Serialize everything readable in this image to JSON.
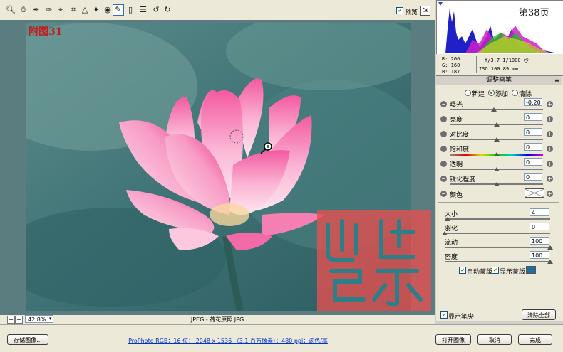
{
  "toolbar": {
    "tools": [
      "zoom-icon",
      "hand-icon",
      "white-balance-icon",
      "color-sampler-icon",
      "target-adjustment-icon",
      "crop-icon",
      "straighten-icon",
      "spot-removal-icon",
      "red-eye-icon",
      "adjustment-brush-icon",
      "graduated-filter-icon",
      "preferences-icon",
      "rotate-left-icon",
      "rotate-right-icon"
    ],
    "preview_label": "预览"
  },
  "image": {
    "caption": "附图31",
    "page_tag": "第38页"
  },
  "status": {
    "zoom": "42.8%",
    "filename": "JPEG - 荷花原照.JPG"
  },
  "info": {
    "r": "R:  206",
    "g": "G:  160",
    "b": "B:  187",
    "exposure": "f/3.7   1/1000 秒",
    "iso": "ISO 100   89 mm"
  },
  "panel": {
    "title": "调整画笔",
    "modes": [
      "新建",
      "添加",
      "清除"
    ],
    "active_mode": 1,
    "sliders": [
      {
        "label": "曝光",
        "value": "-0.20",
        "pos": 0.47
      },
      {
        "label": "亮度",
        "value": "0",
        "pos": 0.5
      },
      {
        "label": "对比度",
        "value": "0",
        "pos": 0.5
      },
      {
        "label": "饱和度",
        "value": "0",
        "pos": 0.5
      },
      {
        "label": "透明",
        "value": "0",
        "pos": 0.5
      },
      {
        "label": "锐化程度",
        "value": "0",
        "pos": 0.5
      }
    ],
    "color_label": "颜色",
    "brush": [
      {
        "label": "大小",
        "value": "4",
        "pos": 0.03
      },
      {
        "label": "羽化",
        "value": "0",
        "pos": 0.0
      },
      {
        "label": "流动",
        "value": "100",
        "pos": 1.0
      },
      {
        "label": "密度",
        "value": "100",
        "pos": 1.0
      }
    ],
    "auto_mask": "自动蒙版",
    "show_mask": "显示蒙版",
    "mask_color": "#1e6ea0",
    "show_pins": "显示笔尖",
    "clear_all": "清除全部"
  },
  "bottom": {
    "save": "存储图像...",
    "workflow": "ProPhoto RGB；16 位； 2048 x 1536 （3.1 百万像素）；480 ppi；滤色/高",
    "open": "打开图像",
    "cancel": "取消",
    "done": "完成"
  },
  "colors": {
    "accent": "#316ac5",
    "background": "#ece9d8",
    "stamp": "#e05050"
  }
}
